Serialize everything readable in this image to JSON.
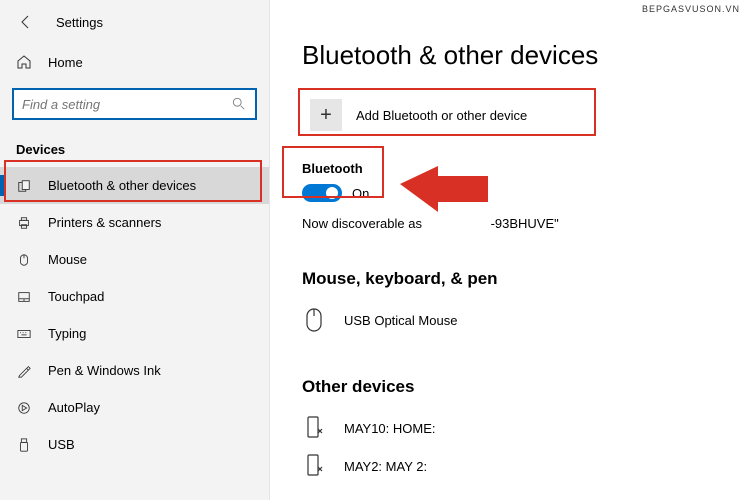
{
  "header": {
    "app_title": "Settings"
  },
  "home": {
    "label": "Home"
  },
  "search": {
    "placeholder": "Find a setting"
  },
  "devices_section": {
    "title": "Devices"
  },
  "sidebar": {
    "items": [
      {
        "label": "Bluetooth & other devices"
      },
      {
        "label": "Printers & scanners"
      },
      {
        "label": "Mouse"
      },
      {
        "label": "Touchpad"
      },
      {
        "label": "Typing"
      },
      {
        "label": "Pen & Windows Ink"
      },
      {
        "label": "AutoPlay"
      },
      {
        "label": "USB"
      }
    ]
  },
  "main": {
    "page_title": "Bluetooth & other devices",
    "add_device_label": "Add Bluetooth or other device",
    "bluetooth_label": "Bluetooth",
    "toggle_state": "On",
    "discoverable_text": "Now discoverable as                   -93BHUVE\"",
    "mouse_section": "Mouse, keyboard, & pen",
    "mouse_device": "USB Optical Mouse",
    "other_section": "Other devices",
    "other_devices": [
      {
        "label": "MAY10: HOME:"
      },
      {
        "label": "MAY2: MAY 2:"
      }
    ]
  },
  "watermark": "BEPGASVUSON.VN"
}
